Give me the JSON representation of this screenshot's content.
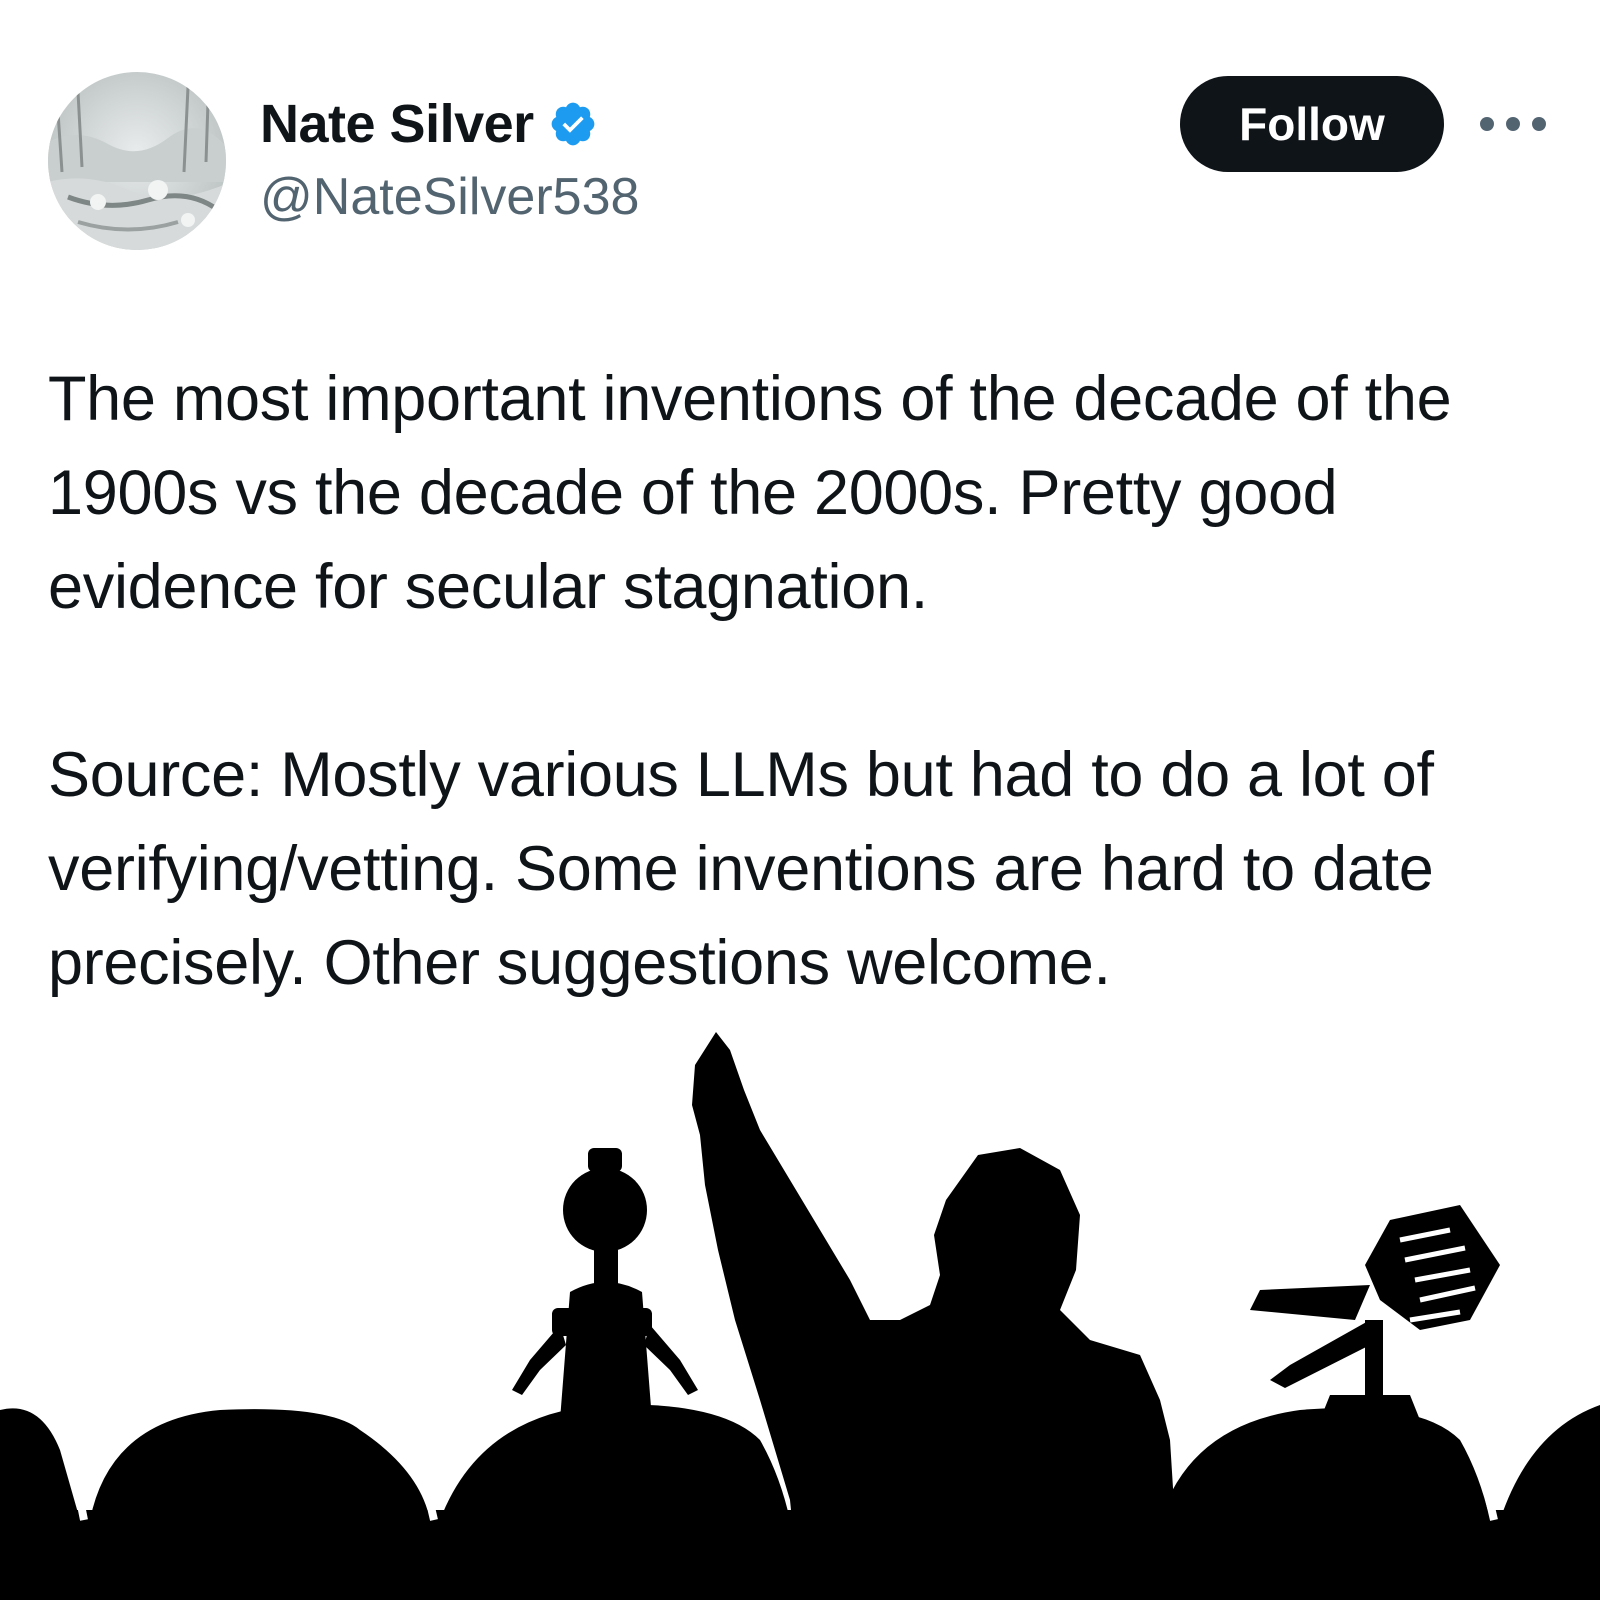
{
  "tweet": {
    "author": {
      "display_name": "Nate Silver",
      "handle": "@NateSilver538",
      "verified": true,
      "avatar_icon": "snowy-creek-avatar"
    },
    "follow_label": "Follow",
    "more_icon": "more-horizontal-icon",
    "text_paragraphs": [
      "The most important inventions of the decade of the 1900s vs the decade of the 2000s. Pretty good evidence for secular stagnation.",
      "Source: Mostly various LLMs but had to do a lot of verifying/vetting. Some inventions are hard to date precisely. Other suggestions welcome."
    ],
    "media": {
      "description_icon": "theater-silhouette-image"
    }
  },
  "colors": {
    "text_primary": "#0f1419",
    "text_secondary": "#536471",
    "verified_blue": "#1d9bf0",
    "follow_bg": "#0f1419",
    "follow_text": "#ffffff",
    "silhouette": "#000000"
  }
}
